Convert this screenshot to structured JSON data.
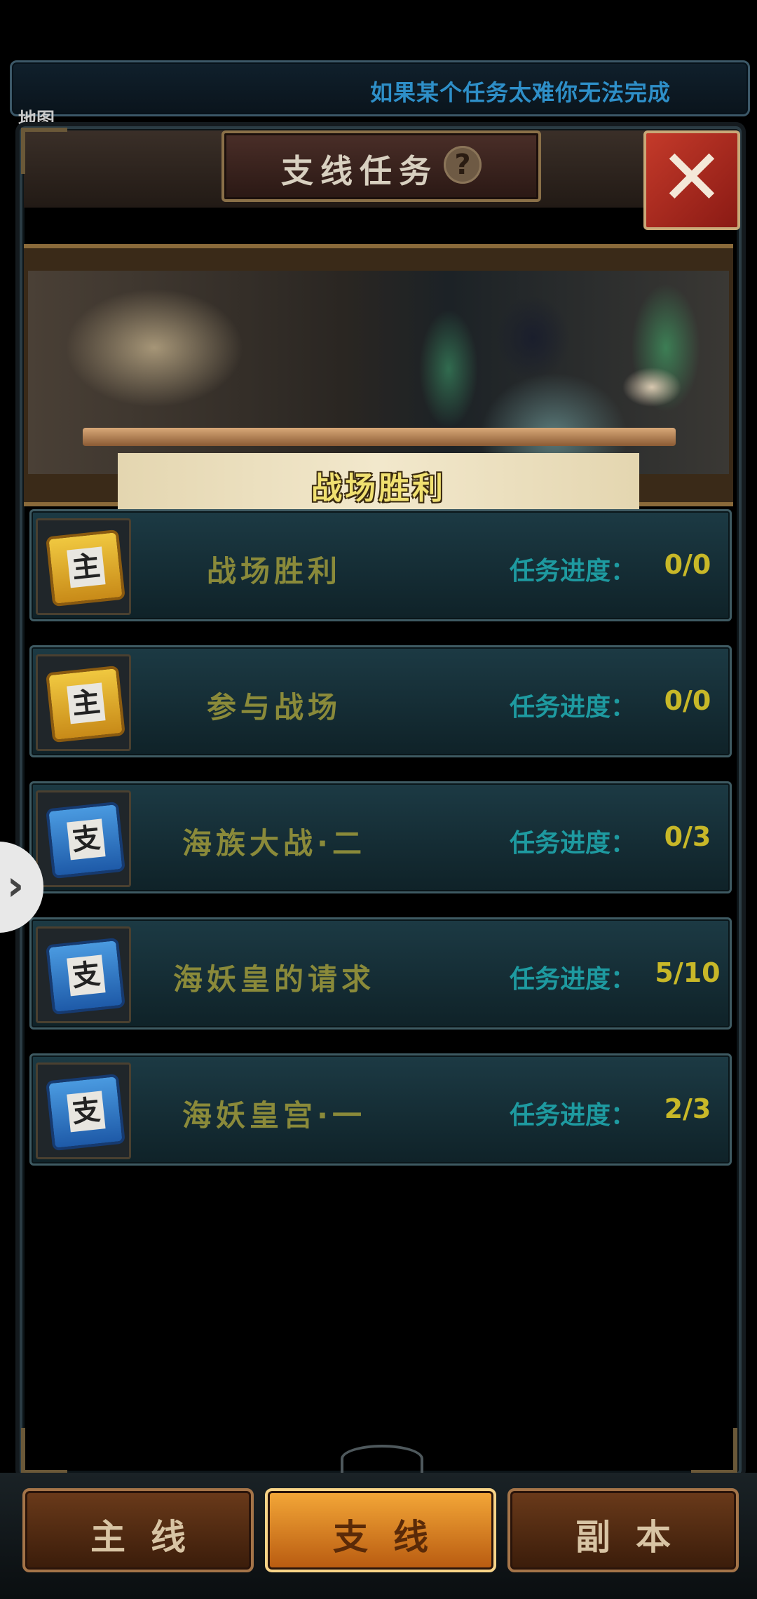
{
  "hint_ribbon": {
    "text": "如果某个任务太难你无法完成"
  },
  "map_tag": "地图",
  "header": {
    "title": "支线任务",
    "help": "?",
    "close": "✕"
  },
  "banner": {
    "subtitle": "战场胜利"
  },
  "quests": [
    {
      "name": "战场胜利",
      "icon_glyph": "主",
      "icon_color": "gold",
      "progress_label": "任务进度：",
      "progress": "0/0"
    },
    {
      "name": "参与战场",
      "icon_glyph": "主",
      "icon_color": "gold",
      "progress_label": "任务进度：",
      "progress": "0/0"
    },
    {
      "name": "海族大战·二",
      "icon_glyph": "支",
      "icon_color": "blue",
      "progress_label": "任务进度：",
      "progress": "0/3"
    },
    {
      "name": "海妖皇的请求",
      "icon_glyph": "支",
      "icon_color": "blue",
      "progress_label": "任务进度：",
      "progress": "5/10"
    },
    {
      "name": "海妖皇宫·一",
      "icon_glyph": "支",
      "icon_color": "blue",
      "progress_label": "任务进度：",
      "progress": "2/3"
    }
  ],
  "side_handle": "›",
  "tabs": [
    {
      "label": "主线",
      "active": false
    },
    {
      "label": "支线",
      "active": true
    },
    {
      "label": "副本",
      "active": false
    }
  ],
  "colors": {
    "progress_label": "#1e9aa0",
    "progress_value": "#c8b828",
    "quest_name": "#8a8a3a",
    "ribbon_text": "#2e8fc8"
  }
}
